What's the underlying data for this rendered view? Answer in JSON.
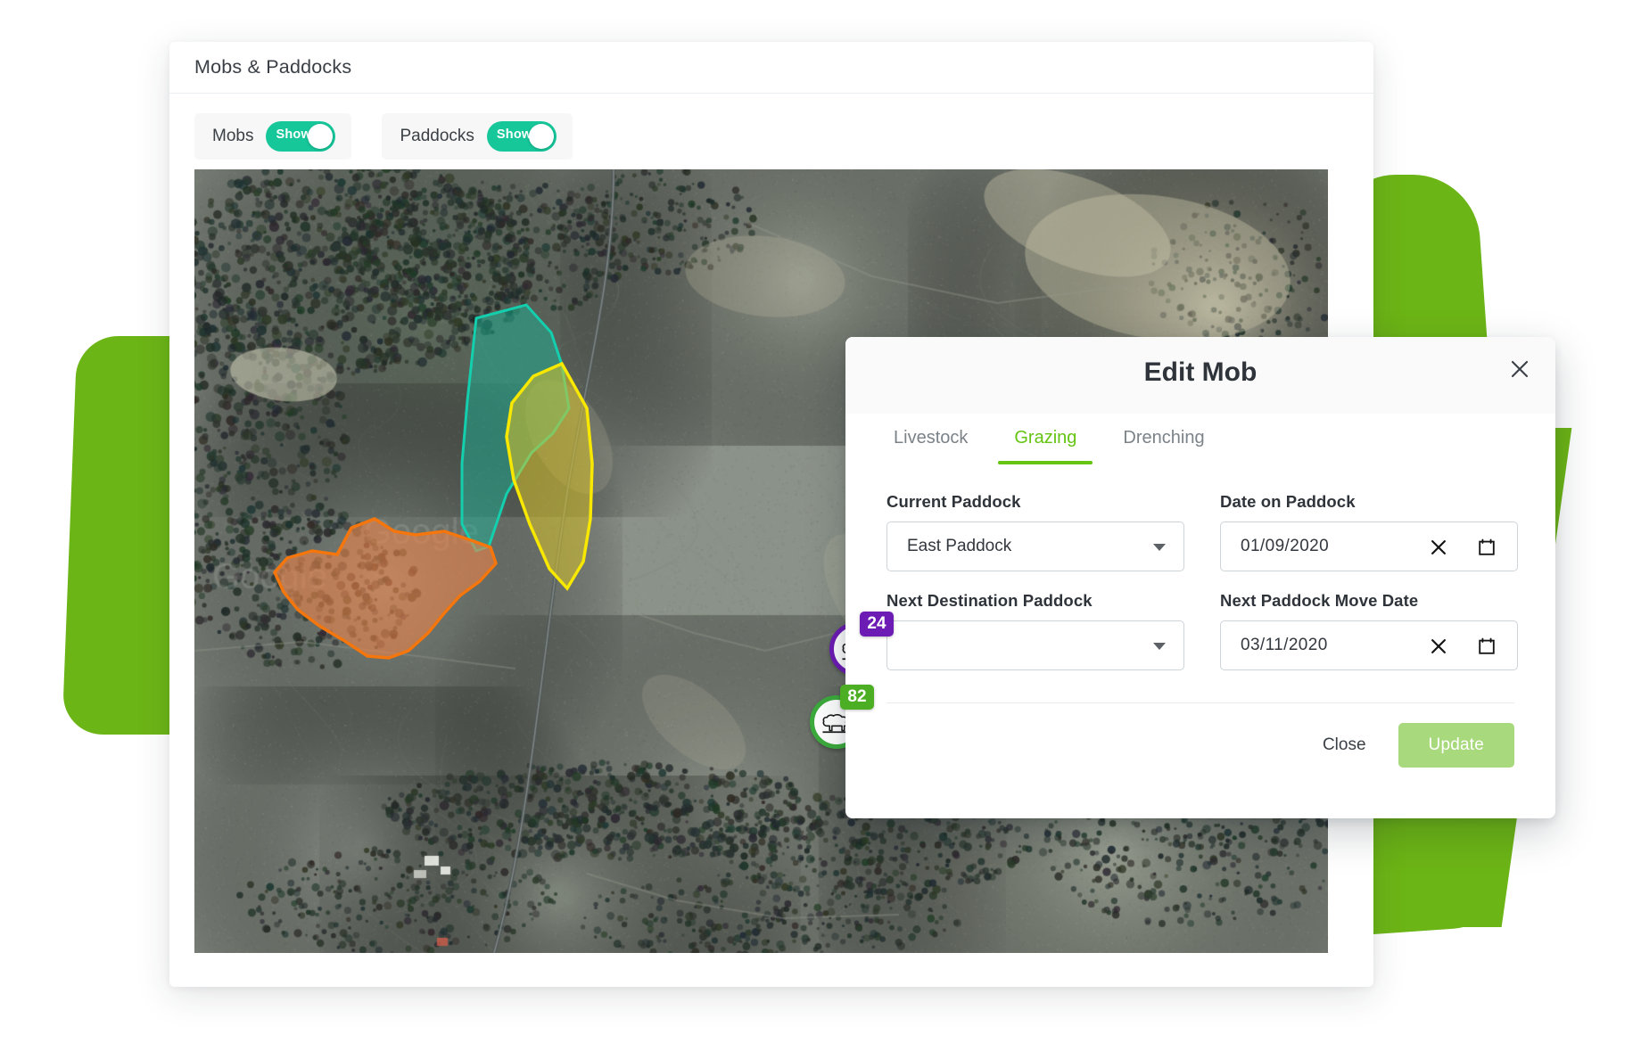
{
  "card": {
    "title": "Mobs & Paddocks"
  },
  "toggles": [
    {
      "label": "Mobs",
      "state_text": "Show",
      "on": true
    },
    {
      "label": "Paddocks",
      "state_text": "Show",
      "on": true
    }
  ],
  "map": {
    "markers": [
      {
        "name": "mob-marker-purple",
        "count": "24",
        "color": "#6d1bb5",
        "icon": "sheep-icon"
      },
      {
        "name": "mob-marker-green",
        "count": "82",
        "color": "#4caf23",
        "icon": "sheep-icon"
      }
    ],
    "paddocks": [
      {
        "name": "teal-paddock",
        "fill": "#1fb89a",
        "stroke": "#12c3a4"
      },
      {
        "name": "yellow-paddock",
        "fill": "#d7c22e",
        "stroke": "#f5e400"
      },
      {
        "name": "orange-paddock",
        "fill": "#e8834a",
        "stroke": "#f4760c"
      }
    ]
  },
  "dialog": {
    "title": "Edit Mob",
    "close_icon": "close-icon",
    "tabs": [
      {
        "label": "Livestock",
        "active": false
      },
      {
        "label": "Grazing",
        "active": true
      },
      {
        "label": "Drenching",
        "active": false
      }
    ],
    "fields": {
      "current_paddock": {
        "label": "Current Paddock",
        "value": "East Paddock",
        "placeholder": ""
      },
      "date_on_paddock": {
        "label": "Date on Paddock",
        "value": "01/09/2020",
        "clear_icon": "clear-icon",
        "calendar_icon": "calendar-icon"
      },
      "next_destination_paddock": {
        "label": "Next Destination Paddock",
        "value": "",
        "placeholder": ""
      },
      "next_paddock_move_date": {
        "label": "Next Paddock Move Date",
        "value": "03/11/2020",
        "clear_icon": "clear-icon",
        "calendar_icon": "calendar-icon"
      }
    },
    "footer": {
      "close_label": "Close",
      "update_label": "Update"
    }
  },
  "colors": {
    "brand_green": "#6cb516",
    "tab_active": "#64c411",
    "toggle_on": "#16c79a",
    "update_button": "#a8d97c"
  }
}
